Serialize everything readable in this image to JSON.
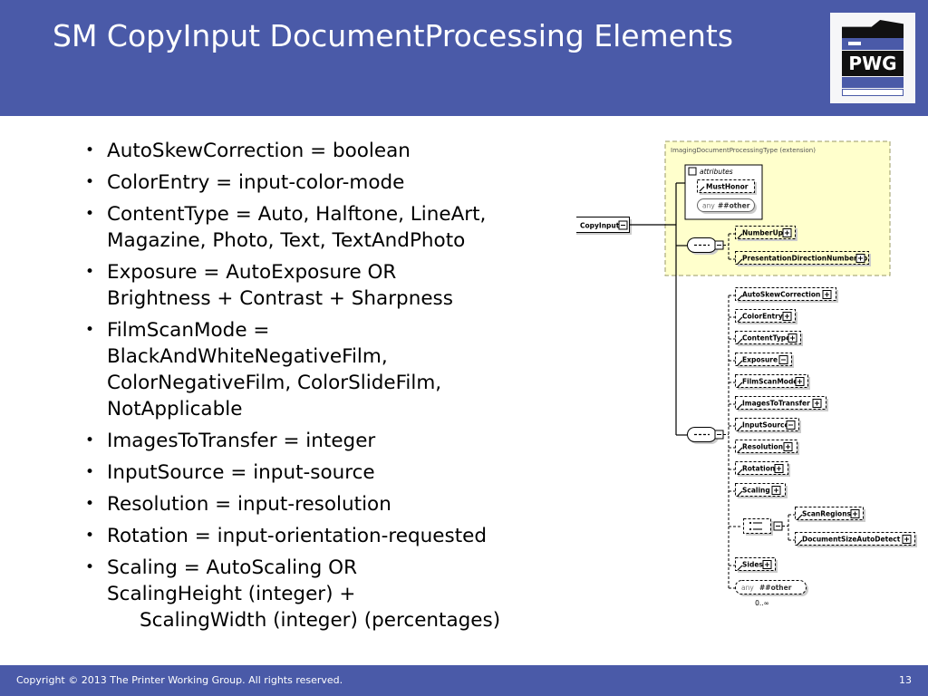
{
  "slide": {
    "title": "SM CopyInput DocumentProcessing Elements",
    "header_color": "#4a5aa8",
    "logo": {
      "name": "pwg-printer-logo",
      "text": "PWG"
    }
  },
  "bullets": [
    {
      "lines": [
        "AutoSkewCorrection = boolean"
      ]
    },
    {
      "lines": [
        "ColorEntry = input-color-mode"
      ]
    },
    {
      "lines": [
        "ContentType = Auto, Halftone, LineArt,",
        "Magazine, Photo, Text, TextAndPhoto"
      ]
    },
    {
      "lines": [
        "Exposure = AutoExposure OR",
        "Brightness + Contrast + Sharpness"
      ]
    },
    {
      "lines": [
        "FilmScanMode =",
        "BlackAndWhiteNegativeFilm,",
        "ColorNegativeFilm, ColorSlideFilm,",
        "NotApplicable"
      ]
    },
    {
      "lines": [
        "ImagesToTransfer = integer"
      ]
    },
    {
      "lines": [
        "InputSource = input-source"
      ]
    },
    {
      "lines": [
        "Resolution = input-resolution"
      ]
    },
    {
      "lines": [
        "Rotation = input-orientation-requested"
      ]
    },
    {
      "lines": [
        "Scaling = AutoScaling OR",
        "ScalingHeight (integer) +"
      ],
      "indented": "ScalingWidth (integer) (percentages)"
    }
  ],
  "footer": {
    "copyright": "Copyright © 2013 The Printer Working Group. All rights reserved.",
    "page_number": "13"
  },
  "diagram": {
    "type": "xsd-schema-tree",
    "background_color": "#ffffcc",
    "group_label": "ImagingDocumentProcessingType (extension)",
    "root_element": "CopyInput",
    "attributes_label": "attributes",
    "attributes": [
      "MustHonor",
      "any ##other"
    ],
    "sequence_symbol": "...",
    "group_children": [
      "NumberUp",
      "PresentationDirectionNumberUp"
    ],
    "elements": [
      "AutoSkewCorrection",
      "ColorEntry",
      "ContentType",
      "Exposure",
      "FilmScanMode",
      "ImagesToTransfer",
      "InputSource",
      "Resolution",
      "Rotation",
      "Scaling"
    ],
    "choice_children": [
      "ScanRegions",
      "DocumentSizeAutoDetect"
    ],
    "tail_elements": [
      "Sides"
    ],
    "any_element": "any ##other",
    "any_cardinality": "0..∞"
  }
}
